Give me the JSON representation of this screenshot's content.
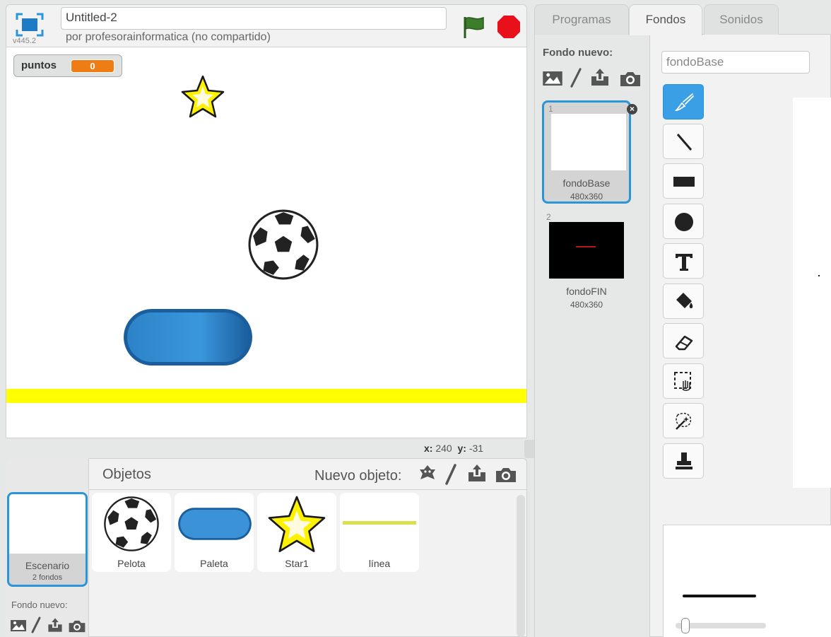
{
  "project": {
    "title": "Untitled-2",
    "author": "por profesorainformatica (no compartido)",
    "version": "v445.2"
  },
  "stage": {
    "variable_monitor": {
      "name": "puntos",
      "value": "0"
    },
    "coords": {
      "x_label": "x:",
      "x_value": "240",
      "y_label": "y:",
      "y_value": "-31"
    }
  },
  "sprite_pane": {
    "title": "Objetos",
    "new_sprite_label": "Nuevo objeto:",
    "stage_thumb": {
      "name": "Escenario",
      "count": "2 fondos"
    },
    "new_backdrop_label": "Fondo nuevo:",
    "sprites": [
      {
        "name": "Pelota"
      },
      {
        "name": "Paleta"
      },
      {
        "name": "Star1"
      },
      {
        "name": "línea"
      }
    ]
  },
  "tabs": [
    {
      "label": "Programas"
    },
    {
      "label": "Fondos"
    },
    {
      "label": "Sonidos"
    }
  ],
  "backdrops_pane": {
    "new_backdrop_label": "Fondo nuevo:",
    "costume_name_value": "fondoBase",
    "delete_icon": "×",
    "costumes": [
      {
        "num": "1",
        "name": "fondoBase",
        "size": "480x360"
      },
      {
        "num": "2",
        "name": "fondoFIN",
        "size": "480x360"
      }
    ]
  },
  "editor_tools": [
    "brush-tool",
    "line-tool",
    "rectangle-tool",
    "ellipse-tool",
    "text-tool",
    "fill-tool",
    "eraser-tool",
    "select-tool",
    "select-and-duplicate-tool",
    "stamp-tool"
  ],
  "colors": {
    "accent": "#2b95d6",
    "orange": "#ee7d16",
    "yellow_line": "#ffff00",
    "stop": "#e8101a",
    "flag": "#3b7d2a"
  }
}
